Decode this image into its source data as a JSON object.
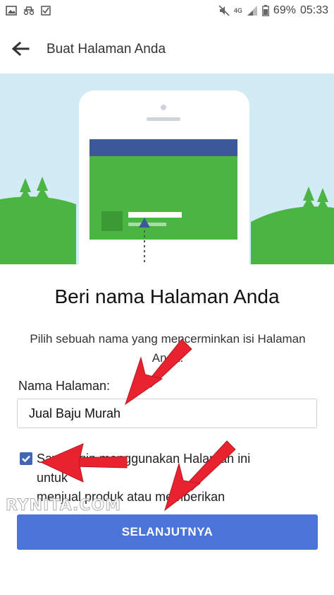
{
  "status_bar": {
    "network": "4G",
    "battery": "69%",
    "time": "05:33"
  },
  "app_bar": {
    "title": "Buat Halaman Anda"
  },
  "form": {
    "heading": "Beri nama Halaman Anda",
    "description": "Pilih sebuah nama yang mencerminkan isi Halaman Anda.",
    "field_label": "Nama Halaman:",
    "field_value": "Jual Baju Murah",
    "checkbox_checked": true,
    "checkbox_text_lines": [
      "Saya ingin menggunakan Halaman ini",
      "untuk",
      "menjual produk atau memberikan"
    ],
    "next_label": "SELANJUTNYA"
  },
  "watermark": "RYNITA.COM",
  "colors": {
    "brand_blue": "#4267b2",
    "button_blue": "#4a74d8",
    "hero_sky": "#d3ebf5",
    "hero_green": "#4bb543",
    "arrow_red": "#e8232f"
  }
}
